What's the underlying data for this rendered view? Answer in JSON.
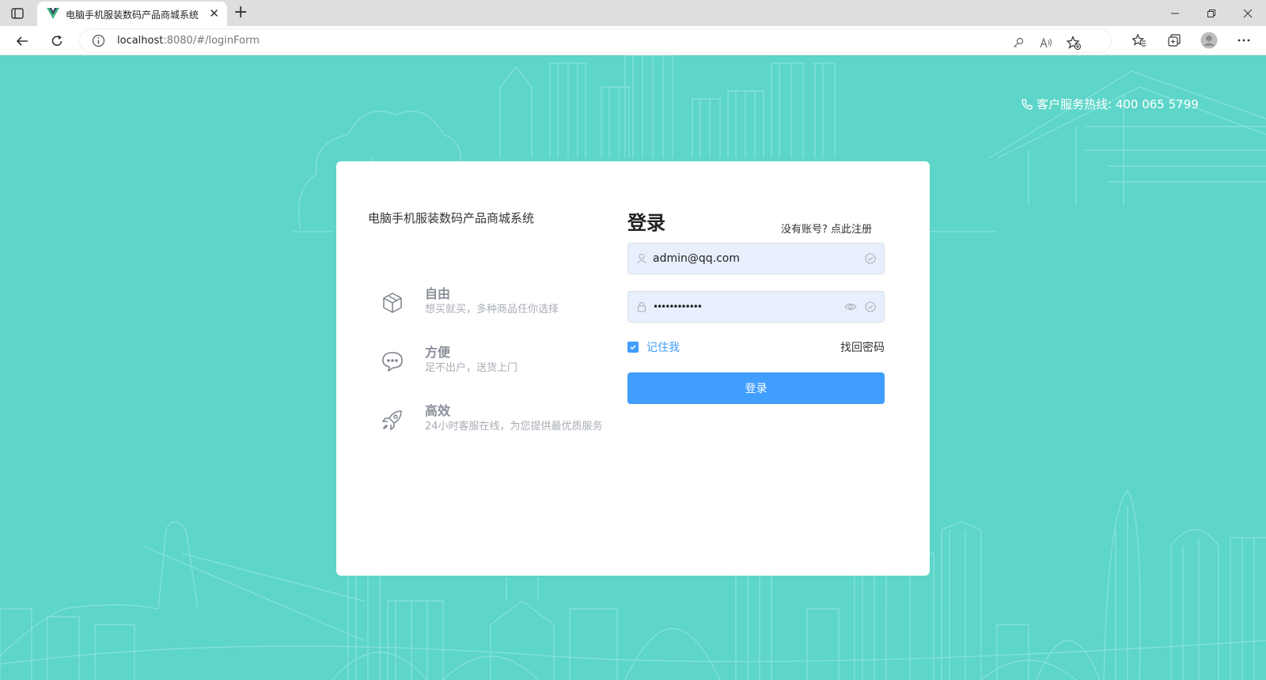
{
  "browser": {
    "tab_title": "电脑手机服装数码产品商城系统",
    "url_host": "localhost",
    "url_path": ":8080/#/loginForm"
  },
  "page": {
    "hotline": "客户服务热线: 400 065 5799",
    "system_name": "电脑手机服装数码产品商城系统",
    "features": [
      {
        "title": "自由",
        "desc": "想买就买，多种商品任你选择",
        "icon": "cube-icon"
      },
      {
        "title": "方便",
        "desc": "足不出户，送货上门",
        "icon": "chat-bubble-icon"
      },
      {
        "title": "高效",
        "desc": "24小时客服在线，为您提供最优质服务",
        "icon": "rocket-icon"
      }
    ],
    "login": {
      "title": "登录",
      "no_account": "没有账号?",
      "register_link": "点此注册",
      "username": "admin@qq.com",
      "password_mask": "••••••••••••",
      "remember_label": "记住我",
      "remember_checked": true,
      "forgot_label": "找回密码",
      "submit_label": "登录"
    }
  },
  "colors": {
    "background": "#5dd5c8",
    "primary": "#409eff",
    "input_fill": "#e8f0fe"
  }
}
